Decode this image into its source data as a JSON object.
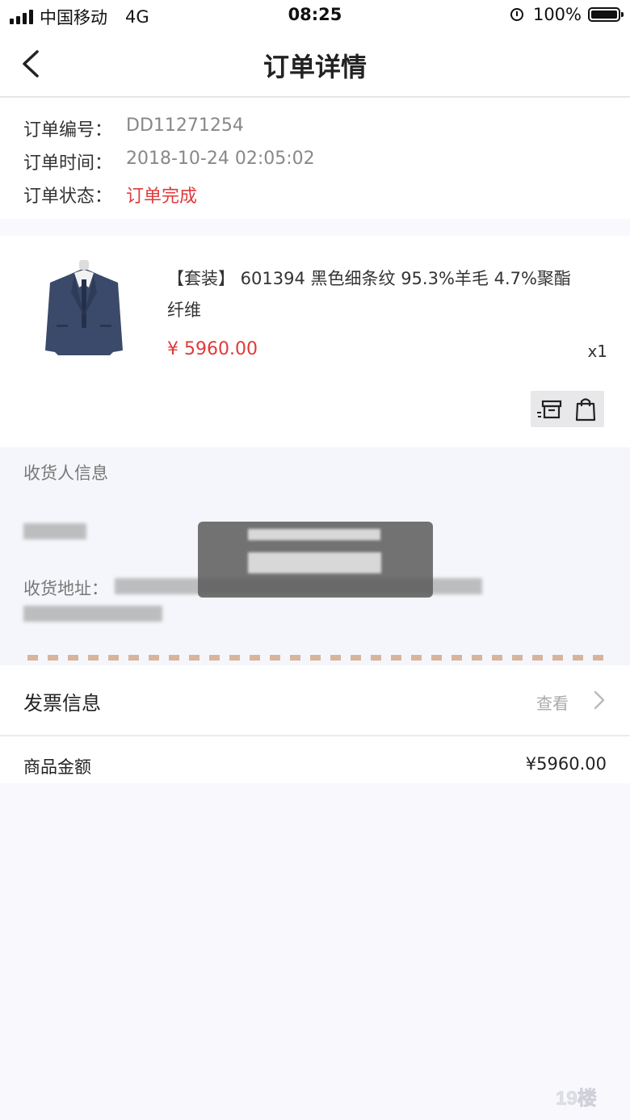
{
  "status_bar": {
    "carrier": "中国移动",
    "network": "4G",
    "time": "08:25",
    "battery": "100%"
  },
  "nav": {
    "title": "订单详情"
  },
  "order_info": {
    "number_label": "订单编号：",
    "number_value": "DD11271254",
    "time_label": "订单时间：",
    "time_value": "2018-10-24 02:05:02",
    "status_label": "订单状态：",
    "status_value": "订单完成"
  },
  "product": {
    "name": "【套装】  601394 黑色细条纹 95.3%羊毛 4.7%聚酯纤维",
    "price": "¥ 5960.00",
    "quantity": "x1"
  },
  "receiver": {
    "title": "收货人信息",
    "address_label": "收货地址："
  },
  "invoice": {
    "title": "发票信息",
    "view_label": "查看"
  },
  "amount": {
    "label": "商品金额",
    "value": "¥5960.00"
  },
  "colors": {
    "accent_red": "#e03a3a",
    "dash_color": "#d8b59a"
  }
}
